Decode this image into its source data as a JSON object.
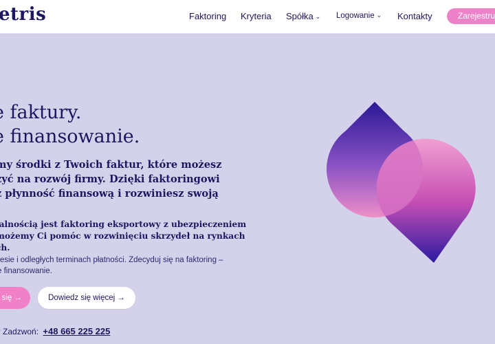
{
  "header": {
    "logo": "etris",
    "nav": [
      {
        "label": "Faktoring"
      },
      {
        "label": "Kryteria"
      },
      {
        "label": "Spółka"
      },
      {
        "label": "Logowanie"
      },
      {
        "label": "Kontakty"
      }
    ],
    "register_label": "Zarejestruj"
  },
  "hero": {
    "title_line1": "e faktury.",
    "title_line2": "e finansowanie.",
    "lead_lines": [
      "my środki z Twoich faktur, które możesz",
      "zyć na rozwój firmy. Dzięki faktoringowi",
      "z płynność finansową i rozwiniesz swoją"
    ],
    "export_lines": [
      "ialnością jest faktoring eksportowy z ubezpieczeniem",
      "możemy Ci pomóc w rozwinięciu skrzydeł na rynkach",
      "ch."
    ],
    "small_lines": [
      "resie i odległych terminach płatności. Zdecyduj się na faktoring –",
      "e finansowanie."
    ],
    "primary_button": "się →",
    "secondary_button": "Dowiedz się więcej →",
    "contact_label": "Zadzwoń:",
    "contact_phone": "+48 665 225 225"
  },
  "colors": {
    "navy": "#1d1660",
    "pink": "#ee82c8",
    "background": "#d4d2ea",
    "violet": "#2b1aa0"
  },
  "icons": {
    "chevron": "chevron-down-icon",
    "phone": "phone-icon"
  }
}
